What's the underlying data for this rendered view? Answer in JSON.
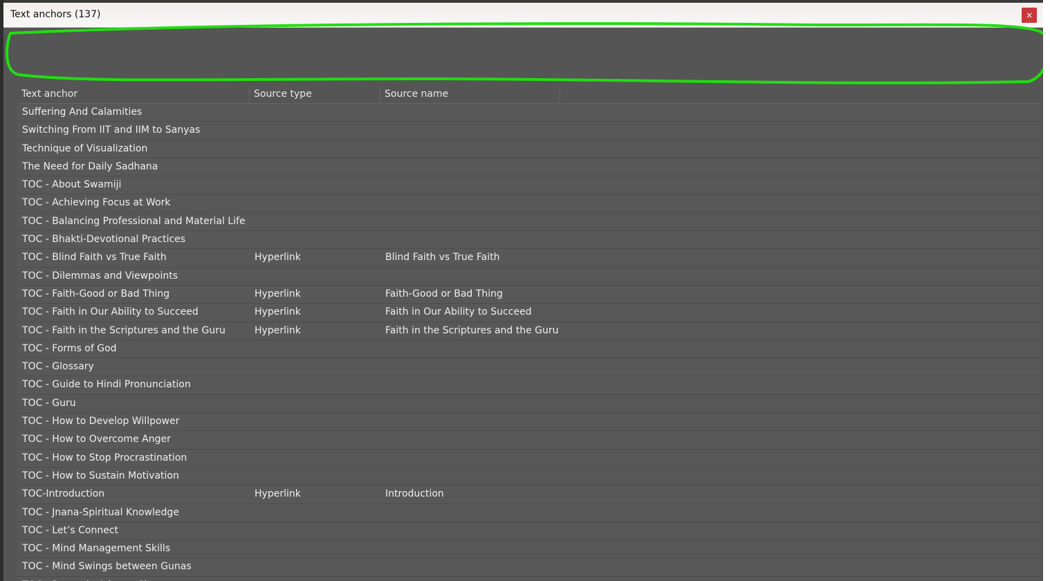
{
  "window": {
    "title": "Text anchors (137)",
    "close_label": "×"
  },
  "columns": [
    "Text anchor",
    "Source type",
    "Source name"
  ],
  "rows": [
    {
      "anchor": "Suffering And Calamities",
      "type": "",
      "name": ""
    },
    {
      "anchor": "Switching From IIT and IIM to Sanyas",
      "type": "",
      "name": ""
    },
    {
      "anchor": "Technique of Visualization",
      "type": "",
      "name": ""
    },
    {
      "anchor": "The Need for Daily Sadhana",
      "type": "",
      "name": ""
    },
    {
      "anchor": "TOC - About Swamiji",
      "type": "",
      "name": ""
    },
    {
      "anchor": "TOC - Achieving Focus at Work",
      "type": "",
      "name": ""
    },
    {
      "anchor": "TOC - Balancing Professional and Material Life",
      "type": "",
      "name": ""
    },
    {
      "anchor": "TOC - Bhakti-Devotional Practices",
      "type": "",
      "name": ""
    },
    {
      "anchor": "TOC - Blind Faith vs True Faith",
      "type": "Hyperlink",
      "name": "Blind Faith vs True Faith"
    },
    {
      "anchor": "TOC - Dilemmas and Viewpoints",
      "type": "",
      "name": ""
    },
    {
      "anchor": "TOC - Faith-Good or Bad Thing",
      "type": "Hyperlink",
      "name": "Faith-Good or Bad Thing"
    },
    {
      "anchor": "TOC - Faith in Our Ability to Succeed",
      "type": "Hyperlink",
      "name": "Faith in Our Ability to Succeed"
    },
    {
      "anchor": "TOC - Faith in the Scriptures and the Guru",
      "type": "Hyperlink",
      "name": "Faith in the Scriptures and the Guru"
    },
    {
      "anchor": "TOC - Forms of God",
      "type": "",
      "name": ""
    },
    {
      "anchor": "TOC - Glossary",
      "type": "",
      "name": ""
    },
    {
      "anchor": "TOC - Guide to Hindi Pronunciation",
      "type": "",
      "name": ""
    },
    {
      "anchor": "TOC - Guru",
      "type": "",
      "name": ""
    },
    {
      "anchor": "TOC - How to Develop Willpower",
      "type": "",
      "name": ""
    },
    {
      "anchor": "TOC - How to Overcome Anger",
      "type": "",
      "name": ""
    },
    {
      "anchor": "TOC - How to Stop Procrastination",
      "type": "",
      "name": ""
    },
    {
      "anchor": "TOC - How to Sustain Motivation",
      "type": "",
      "name": ""
    },
    {
      "anchor": "TOC-Introduction",
      "type": "Hyperlink",
      "name": "Introduction"
    },
    {
      "anchor": "TOC - Jnana-Spiritual Knowledge",
      "type": "",
      "name": ""
    },
    {
      "anchor": "TOC - Let’s Connect",
      "type": "",
      "name": ""
    },
    {
      "anchor": "TOC - Mind Management Skills",
      "type": "",
      "name": ""
    },
    {
      "anchor": "TOC - Mind Swings between Gunas",
      "type": "",
      "name": ""
    },
    {
      "anchor": "TOC - Prayer in Advaya Cinmaya",
      "type": "",
      "name": ""
    }
  ],
  "colors": {
    "dialog_bg": "#555555",
    "close_bg": "#c8383b",
    "annotation": "#22dd11"
  }
}
